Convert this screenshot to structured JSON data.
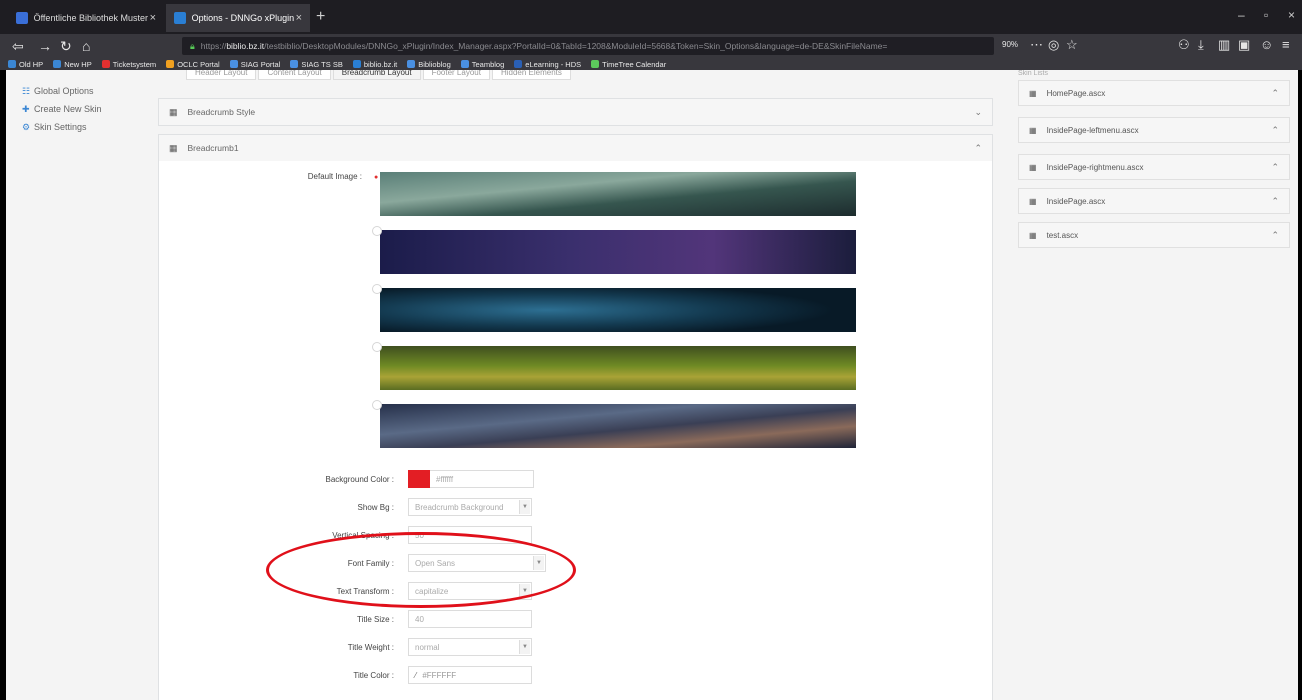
{
  "browser": {
    "tabs": [
      {
        "label": "Öffentliche Bibliothek Muster",
        "close": "×"
      },
      {
        "label": "Options - DNNGo xPlugin - xF",
        "close": "×"
      }
    ],
    "new_tab": "+",
    "window_controls": {
      "minimize": "–",
      "maximize": "▫",
      "close": "×"
    },
    "url": {
      "prefix": "https://",
      "host": "biblio.bz.it",
      "path": "/testbiblio/DesktopModules/DNNGo_xPlugin/Index_Manager.aspx?PortalId=0&TabId=1208&ModuleId=5668&Token=Skin_Options&language=de-DE&SkinFileName="
    },
    "zoom": "90%",
    "bookmarks": [
      {
        "label": "Old HP",
        "color": "#3b87d4"
      },
      {
        "label": "New HP",
        "color": "#3b87d4"
      },
      {
        "label": "Ticketsystem",
        "color": "#e23030"
      },
      {
        "label": "OCLC Portal",
        "color": "#f0a020"
      },
      {
        "label": "SIAG Portal",
        "color": "#4a90e2"
      },
      {
        "label": "SIAG TS SB",
        "color": "#4a90e2"
      },
      {
        "label": "biblio.bz.it",
        "color": "#2a7fd4"
      },
      {
        "label": "Biblioblog",
        "color": "#4a90e2"
      },
      {
        "label": "Teamblog",
        "color": "#4a90e2"
      },
      {
        "label": "eLearning - HDS",
        "color": "#2a5fb4"
      },
      {
        "label": "TimeTree Calendar",
        "color": "#5cc85c"
      }
    ]
  },
  "sidenav": {
    "items": [
      {
        "icon": "☷",
        "label": "Global Options"
      },
      {
        "icon": "✚",
        "label": "Create New Skin"
      },
      {
        "icon": "⚙",
        "label": "Skin Settings"
      }
    ]
  },
  "layout_tabs": [
    "Header Layout",
    "Content Layout",
    "Breadcrumb Layout",
    "Footer Layout",
    "Hidden Elements"
  ],
  "panels": {
    "breadcrumb_style": {
      "title": "Breadcrumb Style",
      "icon": "▦",
      "chevron": "⌄"
    },
    "breadcrumb1": {
      "title": "Breadcrumb1",
      "icon": "▦",
      "chevron": "⌃"
    }
  },
  "form": {
    "default_image_label": "Default Image :",
    "selected_marker": "●",
    "background_color_label": "Background Color :",
    "background_color_value": "#ffffff",
    "show_bg_label": "Show Bg :",
    "show_bg_value": "Breadcrumb Background",
    "vertical_spacing_label": "Vertical Spacing :",
    "vertical_spacing_value": "50",
    "font_family_label": "Font Family :",
    "font_family_value": "Open Sans",
    "text_transform_label": "Text Transform :",
    "text_transform_value": "capitalize",
    "title_size_label": "Title Size :",
    "title_size_value": "40",
    "title_weight_label": "Title Weight :",
    "title_weight_value": "normal",
    "title_color_label": "Title Color :",
    "title_color_value": "#FFFFFF",
    "dropdown_arrow": "▼",
    "swatch_color": "#e31e24",
    "highlight_color": "#e0101a"
  },
  "skin_files": {
    "header": "Skin Lists",
    "items": [
      {
        "name": "HomePage.ascx"
      },
      {
        "name": "InsidePage-leftmenu.ascx"
      },
      {
        "name": "InsidePage-rightmenu.ascx"
      },
      {
        "name": "InsidePage.ascx"
      },
      {
        "name": "test.ascx"
      }
    ],
    "icon": "▦",
    "chevron": "⌃"
  }
}
